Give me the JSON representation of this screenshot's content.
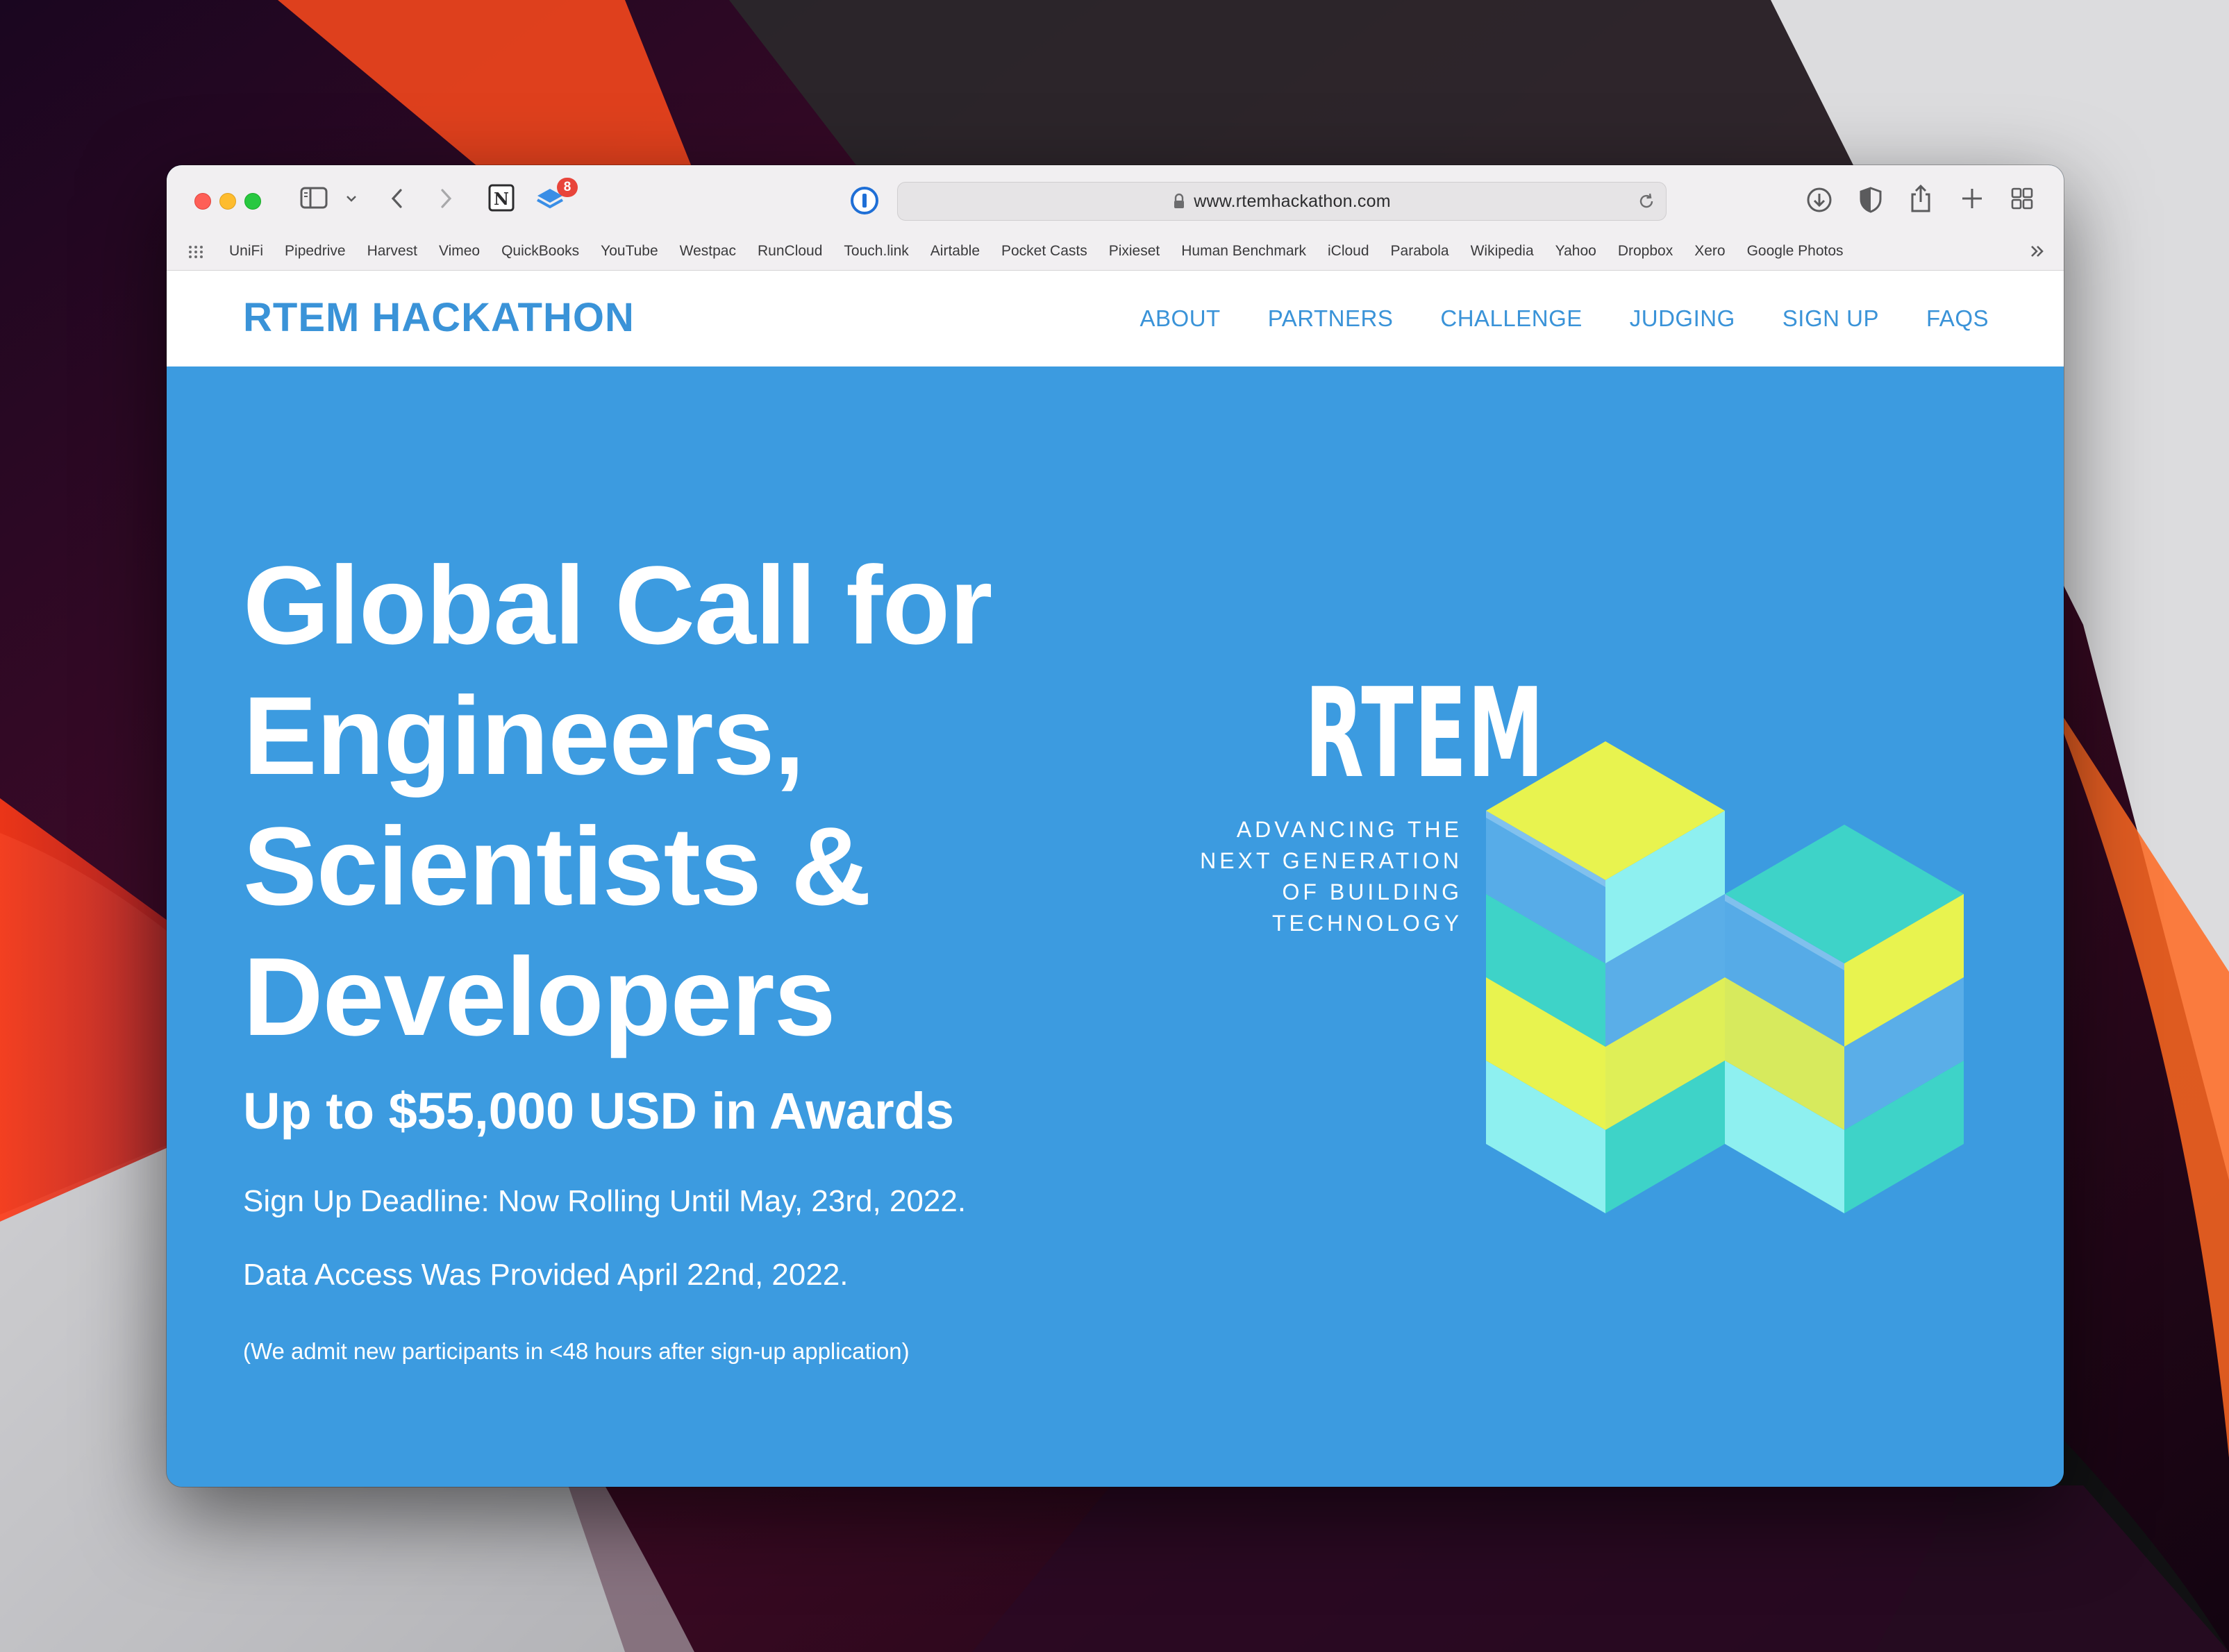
{
  "browser": {
    "notification_count": "8",
    "url": "www.rtemhackathon.com",
    "bookmarks": [
      "UniFi",
      "Pipedrive",
      "Harvest",
      "Vimeo",
      "QuickBooks",
      "YouTube",
      "Westpac",
      "RunCloud",
      "Touch.link",
      "Airtable",
      "Pocket Casts",
      "Pixieset",
      "Human Benchmark",
      "iCloud",
      "Parabola",
      "Wikipedia",
      "Yahoo",
      "Dropbox",
      "Xero",
      "Google Photos"
    ],
    "icons": [
      "sidebar-icon",
      "chevron-down-icon",
      "back-icon",
      "forward-icon",
      "notion-icon",
      "layers-icon",
      "onepassword-icon",
      "lock-icon",
      "reload-icon",
      "download-icon",
      "shield-icon",
      "share-icon",
      "new-tab-icon",
      "tab-overview-icon",
      "grid-icon",
      "more-icon"
    ]
  },
  "site": {
    "logo": "RTEM HACKATHON",
    "nav": [
      "ABOUT",
      "PARTNERS",
      "CHALLENGE",
      "JUDGING",
      "SIGN UP",
      "FAQS"
    ]
  },
  "hero": {
    "title_lines": [
      "Global Call for",
      "Engineers,",
      "Scientists &",
      "Developers"
    ],
    "subtitle": "Up to $55,000 USD in Awards",
    "deadline": "Sign Up Deadline: Now Rolling Until May, 23rd, 2022.",
    "data_access": "Data Access Was Provided April 22nd, 2022.",
    "note": "(We admit new participants in <48 hours after sign-up application)"
  },
  "brand_graphic": {
    "wordmark": "RTEM",
    "tagline_lines": [
      "ADVANCING THE",
      "NEXT GENERATION",
      "OF BUILDING",
      "TECHNOLOGY"
    ],
    "colors": {
      "yellow": "#e8f34f",
      "teal": "#3ed3c8",
      "cyan": "#8ef0f0",
      "blue": "#5aaee8"
    }
  },
  "colors": {
    "accent": "#3a93d8",
    "hero_background": "#3c9be0",
    "header_background": "#ffffff"
  }
}
